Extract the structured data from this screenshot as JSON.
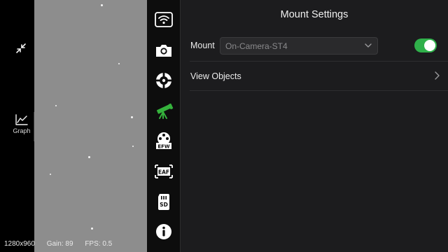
{
  "sidebar_left": {
    "collapse_icon": "collapse-arrows-icon",
    "graph_icon": "line-graph-icon",
    "graph_label": "Graph"
  },
  "status_bar": {
    "resolution": "1280x960",
    "gain": "Gain: 89",
    "fps": "FPS: 0.5"
  },
  "icon_rail": {
    "items": [
      {
        "name": "wifi-icon",
        "active": false
      },
      {
        "name": "camera-icon",
        "active": false
      },
      {
        "name": "guide-crosshair-icon",
        "active": false
      },
      {
        "name": "telescope-mount-icon",
        "active": true
      },
      {
        "name": "EFW",
        "active": false
      },
      {
        "name": "EAF",
        "active": false
      },
      {
        "name": "SD",
        "active": false
      },
      {
        "name": "info-icon",
        "active": false
      }
    ],
    "active_color": "#35b23c",
    "icon_color": "#ffffff"
  },
  "panel": {
    "title": "Mount Settings",
    "mount_label": "Mount",
    "mount_value": "On-Camera-ST4",
    "mount_enabled": true,
    "view_objects_label": "View Objects",
    "toggle_color": "#2fb04a"
  }
}
